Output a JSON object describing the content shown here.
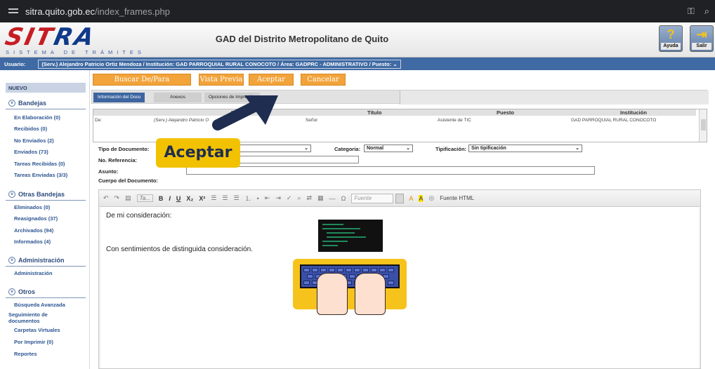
{
  "browser": {
    "url_domain": "sitra.quito.gob.ec",
    "url_path": "/index_frames.php",
    "key_icon": "key-icon",
    "zoom_icon": "zoom-icon"
  },
  "header": {
    "logo_text_red": "SIT",
    "logo_text_blue": "RA",
    "logo_tagline": "SISTEMA DE TRÁMITES",
    "title": "GAD del Distrito Metropolitano de Quito",
    "help_label": "Ayuda",
    "exit_label": "Salir"
  },
  "user": {
    "label": "Usuario:",
    "value": "(Serv.) Alejandro Patricio Ortiz Mendoza / Institución: GAD PARROQUIAL RURAL CONOCOTO / Área: GADPRC - ADMINISTRATIVO / Puesto:"
  },
  "sidebar": {
    "new_label": "NUEVO",
    "section1": "Bandejas",
    "bandejas": [
      "En Elaboración (0)",
      "Recibidos (0)",
      "No Enviados (2)",
      "Enviados (73)",
      "Tareas Recibidas (0)",
      "Tareas Enviadas (3/3)"
    ],
    "section2": "Otras Bandejas",
    "otras": [
      "Eliminados (0)",
      "Reasignados (37)",
      "Archivados (94)",
      "Informados (4)"
    ],
    "section3": "Administración",
    "admin": [
      "Administración"
    ],
    "section4": "Otros",
    "otros": [
      "Búsqueda Avanzada",
      "Seguimiento de documentos",
      "Carpetas Virtuales",
      "Por Imprimir (0)",
      "Reportes"
    ]
  },
  "actions": {
    "buscar": "Buscar De/Para",
    "vista_previa": "Vista Previa",
    "aceptar": "Aceptar",
    "cancelar": "Cancelar"
  },
  "tabs": [
    "Información del Docu",
    "Anexos",
    "Opciones de Impresión"
  ],
  "recipients": {
    "headers": [
      "Nombre",
      "Título",
      "Puesto",
      "Institución"
    ],
    "row": {
      "type": "De:",
      "name": "(Serv.) Alejandro Patricio O",
      "title": "Señor",
      "position": "Asistente de TIC",
      "institution": "GAD PARROQUIAL RURAL CONOCOTO"
    }
  },
  "form": {
    "tipo_label": "Tipo de Documento:",
    "ref_label": "No. Referencia:",
    "asunto_label": "Asunto:",
    "cuerpo_label": "Cuerpo del Documento:",
    "categoria_label": "Categoria:",
    "categoria_value": "Normal",
    "tipificacion_label": "Tipificación:",
    "tipificacion_value": "Sin tipificación"
  },
  "editor": {
    "toolbar": {
      "style_box": "Ta...",
      "bold": "B",
      "italic": "I",
      "underline": "U",
      "subscript": "X₂",
      "superscript": "X²",
      "font_placeholder": "Fuente",
      "source_label": "Fuente HTML"
    },
    "line1": "De mi consideración:",
    "line2": "Con sentimientos de distinguida consideración."
  },
  "callout": {
    "text": "Aceptar"
  },
  "colors": {
    "action_orange": "#f2a33a",
    "nav_blue": "#3f6aa3",
    "callout_yellow": "#f2c200",
    "arrow_navy": "#1e2d50"
  }
}
